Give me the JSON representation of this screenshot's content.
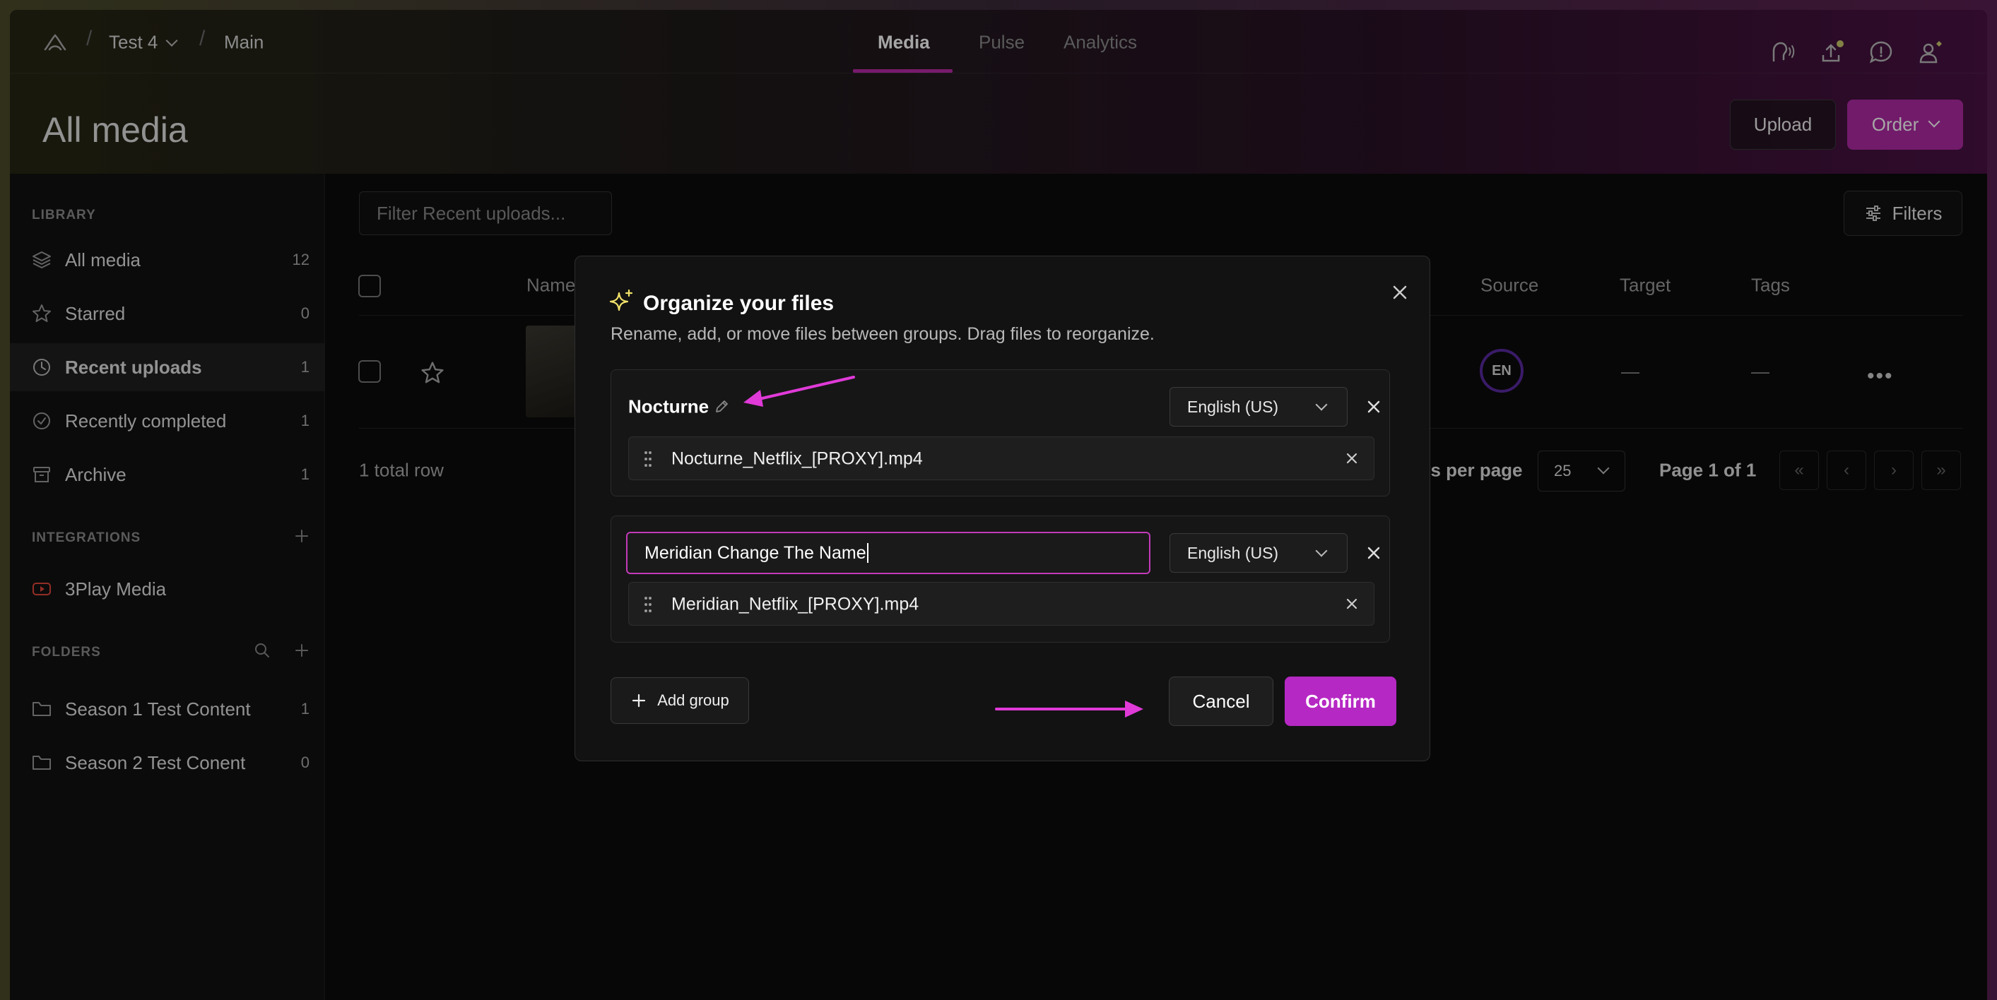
{
  "colors": {
    "accent": "#b628c4",
    "annotation": "#e03ad8",
    "badge_ring": "#5a2aa0"
  },
  "breadcrumb": {
    "workspace": "Test 4",
    "project": "Main",
    "separator": "/"
  },
  "nav_tabs": [
    {
      "label": "Media",
      "active": true
    },
    {
      "label": "Pulse",
      "active": false
    },
    {
      "label": "Analytics",
      "active": false
    }
  ],
  "top_icons": [
    "voice-icon",
    "upload-notify-icon",
    "chat-icon",
    "user-icon"
  ],
  "page": {
    "title": "All media",
    "upload_label": "Upload",
    "order_label": "Order"
  },
  "sidebar": {
    "library_label": "LIBRARY",
    "items": [
      {
        "label": "All media",
        "count": "12",
        "icon": "layers-icon"
      },
      {
        "label": "Starred",
        "count": "0",
        "icon": "star-icon"
      },
      {
        "label": "Recent uploads",
        "count": "1",
        "icon": "clock-icon",
        "active": true
      },
      {
        "label": "Recently completed",
        "count": "1",
        "icon": "check-circle-icon"
      },
      {
        "label": "Archive",
        "count": "1",
        "icon": "archive-icon"
      }
    ],
    "integrations_label": "INTEGRATIONS",
    "integrations": [
      {
        "label": "3Play Media",
        "icon": "youtube-icon"
      }
    ],
    "folders_label": "FOLDERS",
    "folders": [
      {
        "label": "Season 1 Test Content",
        "count": "1"
      },
      {
        "label": "Season 2 Test Conent",
        "count": "0"
      }
    ]
  },
  "main": {
    "filter_placeholder": "Filter Recent uploads...",
    "filters_label": "Filters",
    "columns": {
      "name": "Name",
      "source": "Source",
      "target": "Target",
      "tags": "Tags"
    },
    "row": {
      "source_badge": "EN",
      "target": "—",
      "tags": "—",
      "more": "•••"
    },
    "total_rows": "1 total row",
    "rows_per_page_label": "vs per page",
    "rows_per_page_value": "25",
    "page_of": "Page 1 of 1",
    "pager": [
      "«",
      "‹",
      "›",
      "»"
    ]
  },
  "modal": {
    "title": "Organize your files",
    "subtitle": "Rename, add, or move files between groups. Drag files to reorganize.",
    "groups": [
      {
        "name": "Nocturne",
        "language": "English (US)",
        "file": "Nocturne_Netflix_[PROXY].mp4"
      },
      {
        "name": "Meridian Change The Name",
        "language": "English (US)",
        "file": "Meridian_Netflix_[PROXY].mp4",
        "editing": true
      }
    ],
    "add_group_label": "Add group",
    "cancel_label": "Cancel",
    "confirm_label": "Confirm"
  }
}
